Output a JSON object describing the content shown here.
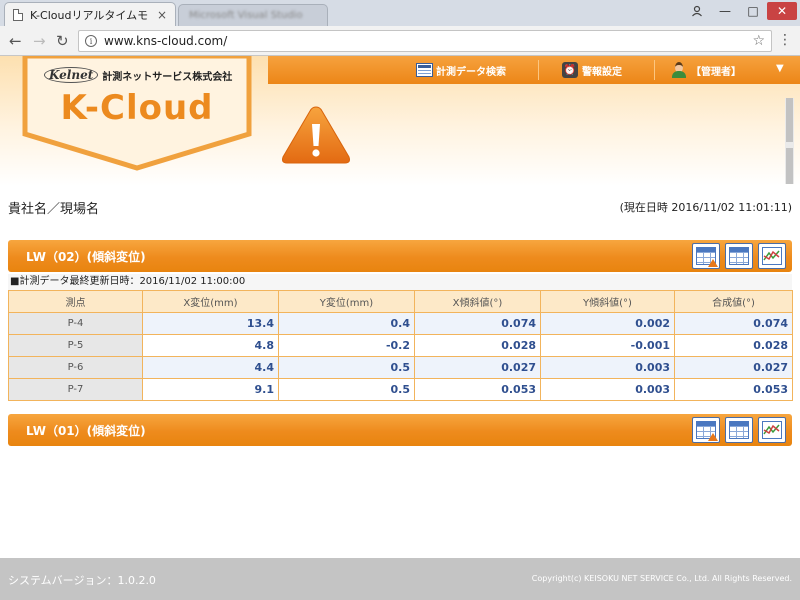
{
  "browser": {
    "tab_title": "K-Cloudリアルタイムモ",
    "tab_close": "×",
    "inactive_tab_title": "Microsoft Visual Studio",
    "url": "www.kns-cloud.com/",
    "min_glyph": "—",
    "max_glyph": "□",
    "close_glyph": "✕"
  },
  "header": {
    "brand_mark": "Kelnet",
    "company_name": "計測ネットサービス株式会社",
    "logo_title": "K-Cloud",
    "nav": {
      "search_label": "計測データ検索",
      "alarm_label": "警報設定",
      "user_label": "【管理者】",
      "caret": "▼"
    }
  },
  "page": {
    "company_site": "貴社名／現場名",
    "current_datetime": "(現在日時 2016/11/02 11:01:11)"
  },
  "sections": [
    {
      "title": "LW（02）(傾斜変位)",
      "last_updated": "■計測データ最終更新日時：2016/11/02 11:00:00",
      "columns": [
        "測点",
        "X変位(mm)",
        "Y変位(mm)",
        "X傾斜値(°)",
        "Y傾斜値(°)",
        "合成値(°)"
      ],
      "rows": [
        [
          "P-4",
          "13.4",
          "0.4",
          "0.074",
          "0.002",
          "0.074"
        ],
        [
          "P-5",
          "4.8",
          "-0.2",
          "0.028",
          "-0.001",
          "0.028"
        ],
        [
          "P-6",
          "4.4",
          "0.5",
          "0.027",
          "0.003",
          "0.027"
        ],
        [
          "P-7",
          "9.1",
          "0.5",
          "0.053",
          "0.003",
          "0.053"
        ]
      ]
    },
    {
      "title": "LW（01）(傾斜変位)"
    }
  ],
  "footer": {
    "version": "システムバージョン：1.0.2.0",
    "copyright": "Copyright(c) KEISOKU NET SERVICE Co., Ltd. All Rights Reserved."
  },
  "colors": {
    "accent_orange": "#ee8b1d",
    "table_header_bg": "#fde9c8",
    "value_text": "#2f4f8f",
    "footer_bg": "#c4c4c4"
  }
}
